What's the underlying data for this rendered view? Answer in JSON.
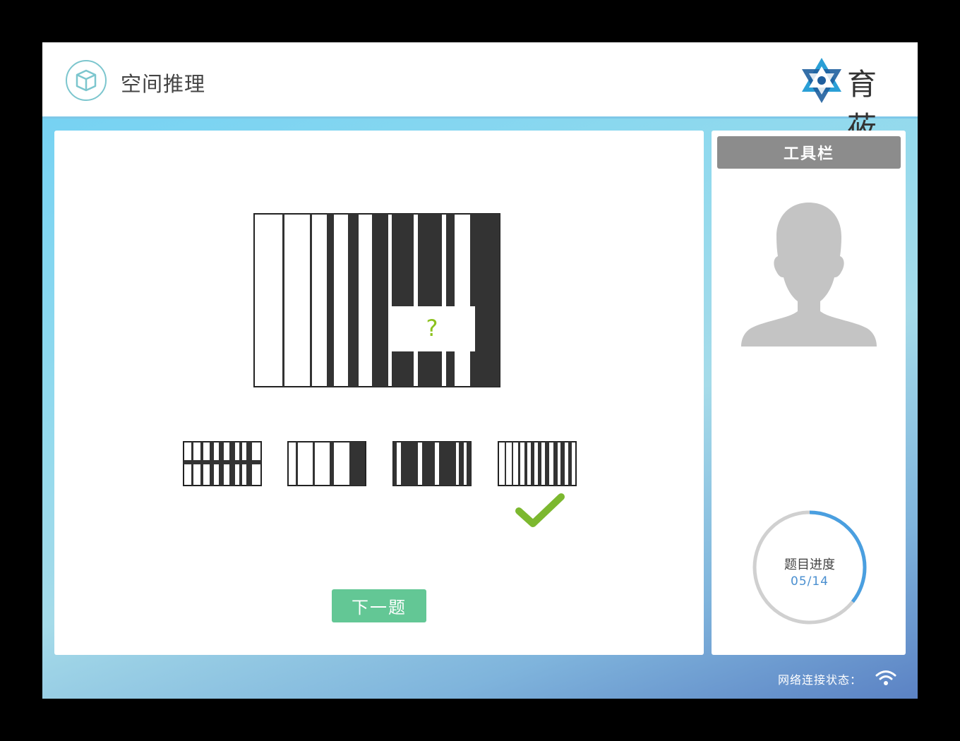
{
  "header": {
    "title": "空间推理",
    "logo_text": "育莜",
    "icon": "cube-icon"
  },
  "question": {
    "placeholder_symbol": "?"
  },
  "options": [
    {
      "id": "A",
      "icon": "option-a-grid-pattern"
    },
    {
      "id": "B",
      "icon": "option-b-stripe-pattern"
    },
    {
      "id": "C",
      "icon": "option-c-stripe-pattern"
    },
    {
      "id": "D",
      "icon": "option-d-stripe-pattern",
      "selected_correct": true
    }
  ],
  "next_button": {
    "label": "下一题"
  },
  "toolbar": {
    "title": "工具栏",
    "avatar_icon": "user-silhouette-icon"
  },
  "progress": {
    "label": "题目进度",
    "value": "05/14",
    "current": 5,
    "total": 14
  },
  "status_bar": {
    "label": "网络连接状态：",
    "icon": "wifi-icon"
  },
  "colors": {
    "accent": "#8dc21f",
    "button": "#63c795",
    "progress": "#4a9fe0",
    "toolbar_header": "#8c8c8c"
  }
}
